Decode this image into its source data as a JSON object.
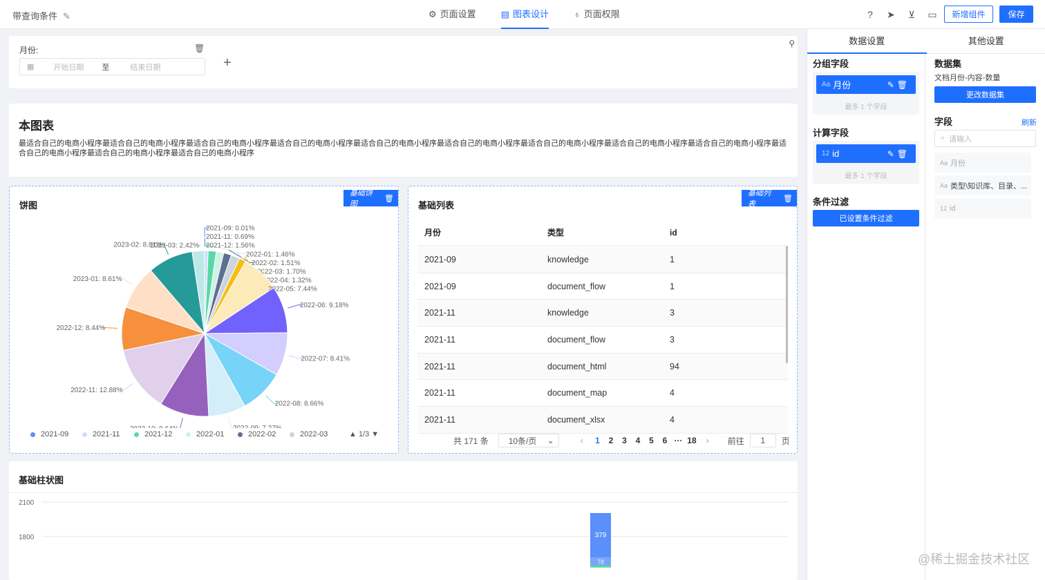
{
  "header": {
    "title": "带查询条件",
    "tabs": [
      {
        "label": "页面设置",
        "icon": "gear-icon"
      },
      {
        "label": "图表设计",
        "icon": "chart-icon"
      },
      {
        "label": "页面权限",
        "icon": "lock-icon"
      }
    ],
    "add_component": "新增组件",
    "save": "保存"
  },
  "filter": {
    "label": "月份:",
    "start_placeholder": "开始日期",
    "to": "至",
    "end_placeholder": "结束日期"
  },
  "text_block": {
    "title": "本图表",
    "body": "最适合自己的电商小程序最适合自己的电商小程序最适合自己的电商小程序最适合自己的电商小程序最适合自己的电商小程序最适合自己的电商小程序最适合自己的电商小程序最适合自己的电商小程序最适合自己的电商小程序最适合自己的电商小程序最适合自己的电商小程序最适合自己的电商小程序"
  },
  "pie": {
    "title": "饼图",
    "tag": "基础饼图",
    "legend": [
      "2021-09",
      "2021-11",
      "2021-12",
      "2022-01",
      "2022-02",
      "2022-03"
    ],
    "legend_colors": [
      "#5b8ff9",
      "#cdddfd",
      "#5ad8a6",
      "#cdf3e4",
      "#5d7092",
      "#ced4de"
    ],
    "legend_page": "1/3"
  },
  "list": {
    "title": "基础列表",
    "tag": "基础列表",
    "columns": [
      "月份",
      "类型",
      "id"
    ],
    "rows": [
      [
        "2021-09",
        "knowledge",
        "1"
      ],
      [
        "2021-09",
        "document_flow",
        "1"
      ],
      [
        "2021-11",
        "knowledge",
        "3"
      ],
      [
        "2021-11",
        "document_flow",
        "3"
      ],
      [
        "2021-11",
        "document_html",
        "94"
      ],
      [
        "2021-11",
        "document_map",
        "4"
      ],
      [
        "2021-11",
        "document_xlsx",
        "4"
      ]
    ],
    "pagination": {
      "total": "共 171 条",
      "page_size": "10条/页",
      "pages": [
        "1",
        "2",
        "3",
        "4",
        "5",
        "6",
        "···",
        "18"
      ],
      "goto": "前往",
      "current": "1",
      "page_unit": "页"
    }
  },
  "bar": {
    "title": "基础柱状图"
  },
  "right_panel": {
    "tabs": [
      "数据设置",
      "其他设置"
    ],
    "group_field_title": "分组字段",
    "group_field": {
      "type": "Aa",
      "name": "月份"
    },
    "group_hint": "最多 1 个字段",
    "calc_field_title": "计算字段",
    "calc_field": {
      "type": "12",
      "name": "id"
    },
    "calc_hint": "最多 1 个字段",
    "condition_title": "条件过滤",
    "condition_button": "已设置条件过滤",
    "dataset_title": "数据集",
    "dataset_name": "文档月份-内容-数量",
    "change_dataset": "更改数据集",
    "fields_title": "字段",
    "refresh": "刷新",
    "search_placeholder": "请输入",
    "fields": [
      {
        "type": "Aa",
        "name": "月份"
      },
      {
        "type": "Aa",
        "name": "类型\\知识库、目录、..."
      },
      {
        "type": "12",
        "name": "id"
      }
    ]
  },
  "watermark": "@稀土掘金技术社区",
  "chart_data": [
    {
      "type": "pie",
      "title": "饼图",
      "slices": [
        {
          "label": "2021-09",
          "value": 0.01,
          "color": "#5b8ff9"
        },
        {
          "label": "2021-11",
          "value": 0.69,
          "color": "#cdddfd"
        },
        {
          "label": "2021-12",
          "value": 1.56,
          "color": "#5ad8a6"
        },
        {
          "label": "2022-01",
          "value": 1.46,
          "color": "#cdf3e4"
        },
        {
          "label": "2022-02",
          "value": 1.51,
          "color": "#5d7092"
        },
        {
          "label": "2022-03",
          "value": 1.7,
          "color": "#ced4de"
        },
        {
          "label": "2022-04",
          "value": 1.32,
          "color": "#f6bd16"
        },
        {
          "label": "2022-05",
          "value": 7.44,
          "color": "#fcebb9"
        },
        {
          "label": "2022-06",
          "value": 9.18,
          "color": "#7262fd"
        },
        {
          "label": "2022-07",
          "value": 8.41,
          "color": "#d3cefd"
        },
        {
          "label": "2022-08",
          "value": 8.66,
          "color": "#78d3f8"
        },
        {
          "label": "2022-09",
          "value": 7.27,
          "color": "#d3eef9"
        },
        {
          "label": "2022-10",
          "value": 9.64,
          "color": "#9661bc"
        },
        {
          "label": "2022-11",
          "value": 12.88,
          "color": "#e0d0ec"
        },
        {
          "label": "2022-12",
          "value": 8.44,
          "color": "#f6903d"
        },
        {
          "label": "2023-01",
          "value": 8.61,
          "color": "#ffe0c7"
        },
        {
          "label": "2023-02",
          "value": 8.81,
          "color": "#269a99"
        },
        {
          "label": "2023-03",
          "value": 2.42,
          "color": "#bde8e6"
        }
      ]
    },
    {
      "type": "bar",
      "title": "基础柱状图",
      "y_ticks": [
        2100,
        1800
      ],
      "bars": [
        {
          "label": "379",
          "color": "#5b8ff9"
        },
        {
          "label": "78",
          "color": "#5ad8a6"
        }
      ]
    }
  ]
}
